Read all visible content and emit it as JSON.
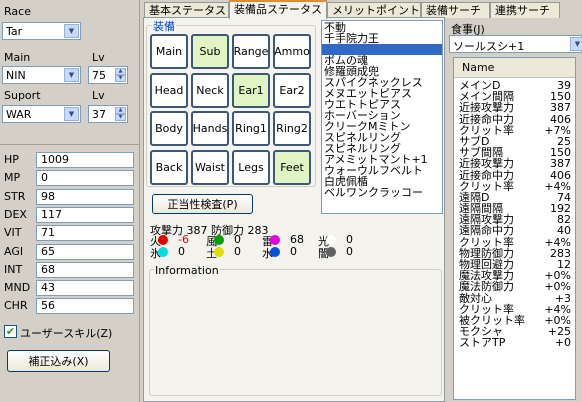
{
  "left": {
    "race_label": "Race",
    "race_value": "Tar",
    "main_label": "Main",
    "main_value": "NIN",
    "main_lv_label": "Lv",
    "main_lv_value": "75",
    "support_label": "Suport",
    "support_value": "WAR",
    "support_lv_label": "Lv",
    "support_lv_value": "37",
    "stats": [
      {
        "label": "HP",
        "value": "1009"
      },
      {
        "label": "MP",
        "value": "0"
      },
      {
        "label": "STR",
        "value": "98"
      },
      {
        "label": "DEX",
        "value": "117"
      },
      {
        "label": "VIT",
        "value": "71"
      },
      {
        "label": "AGI",
        "value": "65"
      },
      {
        "label": "INT",
        "value": "68"
      },
      {
        "label": "MND",
        "value": "43"
      },
      {
        "label": "CHR",
        "value": "56"
      }
    ],
    "user_skill_label": "ユーザースキル(Z)",
    "user_skill_checked": true,
    "correction_button": "補正込み(X)"
  },
  "tabs": [
    "基本ステータス",
    "装備品ステータス",
    "メリットポイント",
    "装備サーチ",
    "連携サーチ"
  ],
  "active_tab": 1,
  "equip": {
    "group_label": "装備",
    "slots": [
      {
        "label": "Main",
        "on": false
      },
      {
        "label": "Sub",
        "on": true
      },
      {
        "label": "Range",
        "on": false
      },
      {
        "label": "Ammo",
        "on": false
      },
      {
        "label": "Head",
        "on": false
      },
      {
        "label": "Neck",
        "on": false
      },
      {
        "label": "Ear1",
        "on": true
      },
      {
        "label": "Ear2",
        "on": false
      },
      {
        "label": "Body",
        "on": false
      },
      {
        "label": "Hands",
        "on": false
      },
      {
        "label": "Ring1",
        "on": false
      },
      {
        "label": "Ring2",
        "on": false
      },
      {
        "label": "Back",
        "on": false
      },
      {
        "label": "Waist",
        "on": false
      },
      {
        "label": "Legs",
        "on": false
      },
      {
        "label": "Feet",
        "on": true
      }
    ],
    "check_button": "正当性検査(P)",
    "atk_def_text": "攻撃力 387 防御力 283",
    "resists_row1": [
      {
        "label": "火",
        "color": "#e00000",
        "value": "-6",
        "value_color": "#e00000"
      },
      {
        "label": "風",
        "color": "#00a000",
        "value": "0",
        "value_color": "#000000"
      },
      {
        "label": "雷",
        "color": "#e000e0",
        "value": "68",
        "value_color": "#000000"
      },
      {
        "label": "光",
        "color": "#ffffff",
        "value": "0",
        "value_color": "#000000"
      }
    ],
    "resists_row2": [
      {
        "label": "氷",
        "color": "#00e0e0",
        "value": "0",
        "value_color": "#000000"
      },
      {
        "label": "土",
        "color": "#e0e000",
        "value": "0",
        "value_color": "#000000"
      },
      {
        "label": "水",
        "color": "#0050e0",
        "value": "0",
        "value_color": "#000000"
      },
      {
        "label": "闇",
        "color": "#606060",
        "value": "0",
        "value_color": "#000000"
      }
    ],
    "info_label": "Information"
  },
  "item_list": [
    "不動",
    "千手院力王",
    "",
    "ボムの魂",
    "修羅頭成兜",
    "スパイクネックレス",
    "メヌエットピアス",
    "ウエトトピアス",
    "ホーバーション",
    "クリークMミトン",
    "スピネルリング",
    "スピネルリング",
    "アメミットマント+1",
    "ウォーウルフベルト",
    "白虎佩楯",
    "ベルワンクラッコー"
  ],
  "item_list_selected": 2,
  "food": {
    "label": "食事(J)",
    "value": "ソールスシ+1"
  },
  "stat_list": {
    "header": "Name",
    "rows": [
      {
        "n": "メインD",
        "v": "39"
      },
      {
        "n": "メイン間隔",
        "v": "150"
      },
      {
        "n": "近接攻撃力",
        "v": "387"
      },
      {
        "n": "近接命中力",
        "v": "406"
      },
      {
        "n": "クリット率",
        "v": "+7%"
      },
      {
        "n": "サブD",
        "v": "25"
      },
      {
        "n": "サブ間隔",
        "v": "150"
      },
      {
        "n": "近接攻撃力",
        "v": "387"
      },
      {
        "n": "近接命中力",
        "v": "406"
      },
      {
        "n": "クリット率",
        "v": "+4%"
      },
      {
        "n": "遠隔D",
        "v": "74"
      },
      {
        "n": "遠隔間隔",
        "v": "192"
      },
      {
        "n": "遠隔攻撃力",
        "v": "82"
      },
      {
        "n": "遠隔命中力",
        "v": "40"
      },
      {
        "n": "クリット率",
        "v": "+4%"
      },
      {
        "n": "物理防御力",
        "v": "283"
      },
      {
        "n": "物理回避力",
        "v": "12"
      },
      {
        "n": "魔法攻撃力",
        "v": "+0%"
      },
      {
        "n": "魔法防御力",
        "v": "+0%"
      },
      {
        "n": "敵対心",
        "v": "+3"
      },
      {
        "n": "クリット率",
        "v": "+4%"
      },
      {
        "n": "被クリット率",
        "v": "+0%"
      },
      {
        "n": "モクシャ",
        "v": "+25"
      },
      {
        "n": "ストアTP",
        "v": "+0"
      }
    ]
  }
}
